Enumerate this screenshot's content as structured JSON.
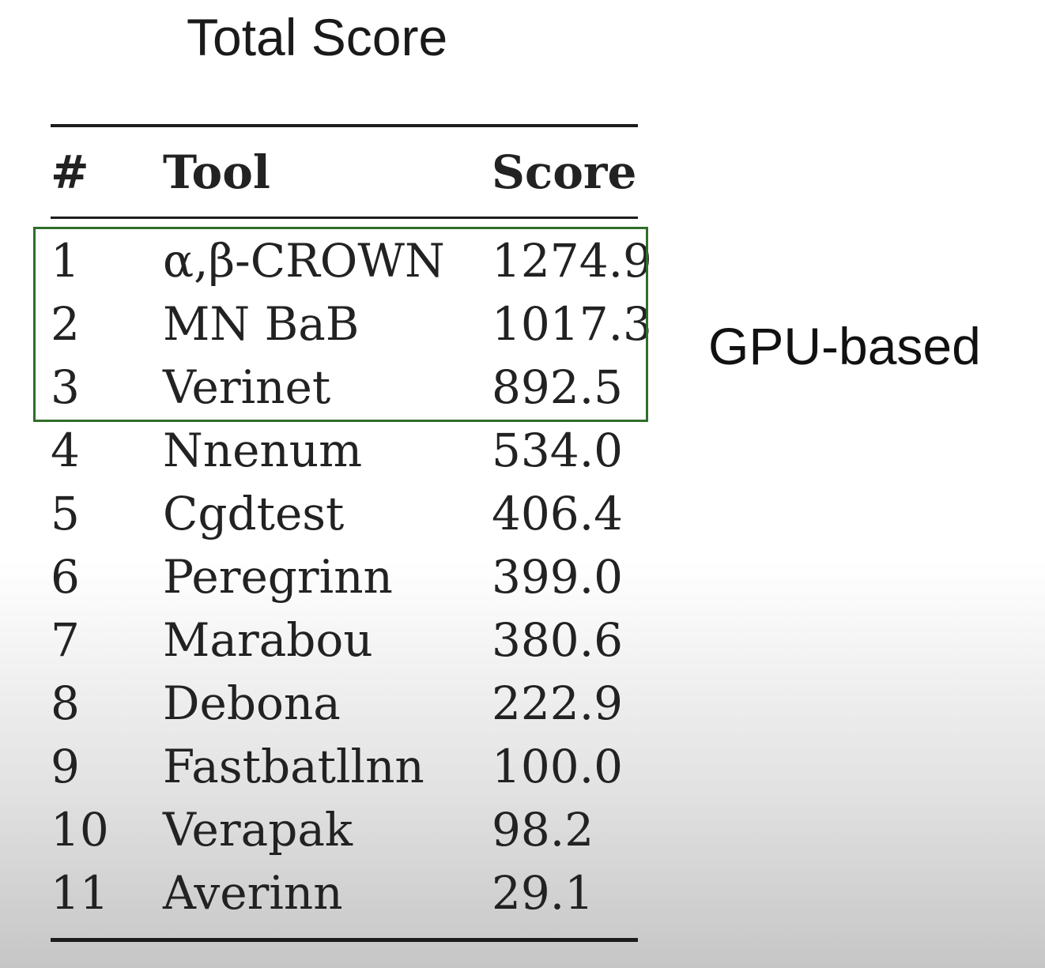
{
  "title": "Total Score",
  "table": {
    "headers": {
      "rank": "#",
      "tool": "Tool",
      "score": "Score"
    },
    "rows": [
      {
        "rank": "1",
        "tool": "α,β-CROWN",
        "score": "1274.9"
      },
      {
        "rank": "2",
        "tool": "MN BaB",
        "score": "1017.3"
      },
      {
        "rank": "3",
        "tool": "Verinet",
        "score": "892.5"
      },
      {
        "rank": "4",
        "tool": "Nnenum",
        "score": "534.0"
      },
      {
        "rank": "5",
        "tool": "Cgdtest",
        "score": "406.4"
      },
      {
        "rank": "6",
        "tool": "Peregrinn",
        "score": "399.0"
      },
      {
        "rank": "7",
        "tool": "Marabou",
        "score": "380.6"
      },
      {
        "rank": "8",
        "tool": "Debona",
        "score": "222.9"
      },
      {
        "rank": "9",
        "tool": "Fastbatllnn",
        "score": "100.0"
      },
      {
        "rank": "10",
        "tool": "Verapak",
        "score": "98.2"
      },
      {
        "rank": "11",
        "tool": "Averinn",
        "score": "29.1"
      }
    ]
  },
  "highlight": {
    "label": "GPU-based",
    "color": "#2f6e2a"
  }
}
